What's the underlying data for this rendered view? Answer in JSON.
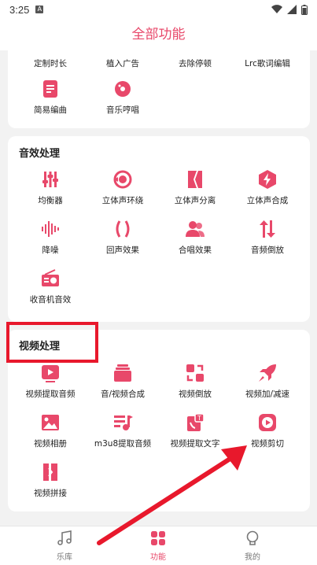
{
  "status_bar": {
    "time": "3:25",
    "badge": "A"
  },
  "header": {
    "title": "全部功能"
  },
  "section_top": {
    "items": [
      {
        "label": "定制时长"
      },
      {
        "label": "植入广告"
      },
      {
        "label": "去除停顿"
      },
      {
        "label": "Lrc歌词编辑"
      },
      {
        "label": "简易编曲",
        "icon": "score-icon"
      },
      {
        "label": "音乐哼唱",
        "icon": "vinyl-icon"
      }
    ]
  },
  "section_audio": {
    "title": "音效处理",
    "items": [
      {
        "label": "均衡器",
        "icon": "equalizer-icon"
      },
      {
        "label": "立体声环绕",
        "icon": "surround-icon"
      },
      {
        "label": "立体声分离",
        "icon": "split-icon"
      },
      {
        "label": "立体声合成",
        "icon": "bolt-icon"
      },
      {
        "label": "降噪",
        "icon": "waveform-icon"
      },
      {
        "label": "回声效果",
        "icon": "parentheses-icon"
      },
      {
        "label": "合唱效果",
        "icon": "people-icon"
      },
      {
        "label": "音频倒放",
        "icon": "reverse-arrows-icon"
      },
      {
        "label": "收音机音效",
        "icon": "radio-icon"
      }
    ]
  },
  "section_video": {
    "title": "视频处理",
    "items": [
      {
        "label": "视频提取音频",
        "icon": "play-box-icon"
      },
      {
        "label": "音/视频合成",
        "icon": "stack-icon"
      },
      {
        "label": "视频倒放",
        "icon": "swap-icon"
      },
      {
        "label": "视频加/减速",
        "icon": "rocket-icon"
      },
      {
        "label": "视频相册",
        "icon": "image-icon"
      },
      {
        "label": "m3u8提取音频",
        "icon": "playlist-icon"
      },
      {
        "label": "视频提取文字",
        "icon": "text-extract-icon"
      },
      {
        "label": "视频剪切",
        "icon": "play-circle-icon"
      },
      {
        "label": "视频拼接",
        "icon": "join-icon"
      }
    ]
  },
  "tabbar": {
    "tabs": [
      {
        "label": "乐库",
        "icon": "music-note-icon",
        "active": false
      },
      {
        "label": "功能",
        "icon": "grid-icon",
        "active": true
      },
      {
        "label": "我的",
        "icon": "bulb-icon",
        "active": false
      }
    ]
  },
  "colors": {
    "accent": "#e8486a",
    "annotation": "#e8182c"
  }
}
